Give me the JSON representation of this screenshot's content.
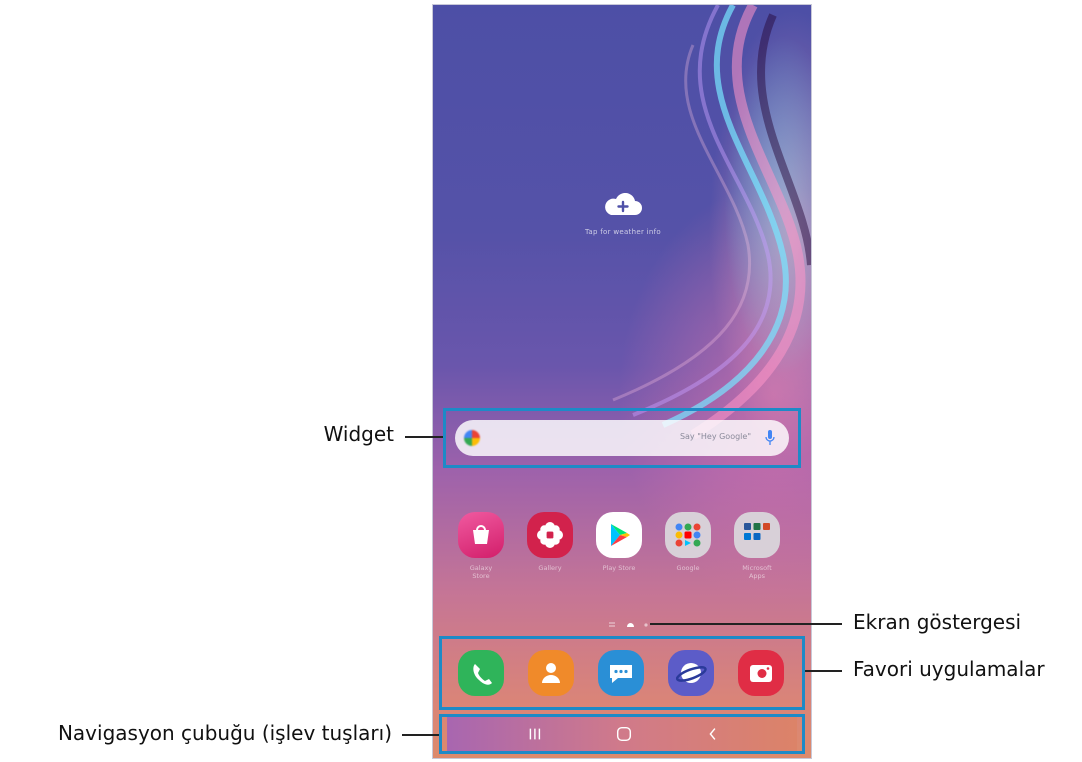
{
  "annotations": {
    "widget": "Widget",
    "screen_indicator": "Ekran göstergesi",
    "favorite_apps": "Favori uygulamalar",
    "nav_bar": "Navigasyon çubuğu (işlev tuşları)"
  },
  "weather": {
    "icon": "cloud-plus-icon",
    "text": "Tap for weather info"
  },
  "search": {
    "placeholder": "Say \"Hey Google\"",
    "logo_icon": "google-logo-icon",
    "mic_icon": "mic-icon"
  },
  "apps": [
    {
      "name": "Galaxy Store",
      "label_line1": "Galaxy",
      "label_line2": "Store",
      "color": "#e0307a",
      "icon": "shopping-bag-icon"
    },
    {
      "name": "Gallery",
      "label_line1": "Gallery",
      "label_line2": "",
      "color": "#d2224c",
      "icon": "flower-icon"
    },
    {
      "name": "Play Store",
      "label_line1": "Play Store",
      "label_line2": "",
      "color": "#ffffff",
      "icon": "play-store-icon"
    },
    {
      "name": "Google",
      "label_line1": "Google",
      "label_line2": "",
      "color": "#d8d0d8",
      "icon": "folder-icon"
    },
    {
      "name": "Microsoft Apps",
      "label_line1": "Microsoft",
      "label_line2": "Apps",
      "color": "#d8d0d8",
      "icon": "folder-icon"
    }
  ],
  "favorites": [
    {
      "name": "Phone",
      "color": "#2fb45a",
      "icon": "phone-icon"
    },
    {
      "name": "Contacts",
      "color": "#f08a2a",
      "icon": "contact-icon"
    },
    {
      "name": "Messages",
      "color": "#2a8fd6",
      "icon": "message-icon"
    },
    {
      "name": "Internet",
      "color": "#5c5cc8",
      "icon": "planet-icon"
    },
    {
      "name": "Camera",
      "color": "#e02d45",
      "icon": "camera-icon"
    }
  ],
  "navigation": {
    "recents": "recents-icon",
    "home": "home-icon",
    "back": "back-icon"
  },
  "colors": {
    "annotation_box": "#1d8ac7",
    "annotation_text": "#111111"
  }
}
